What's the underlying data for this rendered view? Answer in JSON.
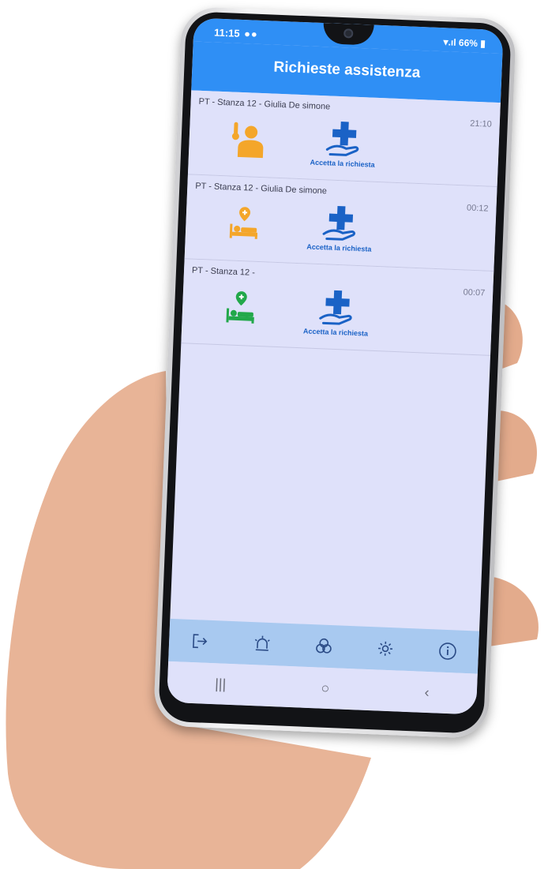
{
  "status_bar": {
    "time": "11:15",
    "battery": "66%"
  },
  "header": {
    "title": "Richieste assistenza"
  },
  "requests": [
    {
      "title": "PT - Stanza 12 - Giulia De simone",
      "time": "21:10",
      "icon": "fever-person-icon",
      "icon_color": "#f4a62a",
      "accept_label": "Accetta la richiesta"
    },
    {
      "title": "PT - Stanza 12 - Giulia De simone",
      "time": "00:12",
      "icon": "bed-alert-icon",
      "icon_color": "#f4a62a",
      "accept_label": "Accetta la richiesta"
    },
    {
      "title": "PT - Stanza 12 -",
      "time": "00:07",
      "icon": "bed-alert-icon",
      "icon_color": "#22a84a",
      "accept_label": "Accetta la richiesta"
    }
  ],
  "tabs": [
    {
      "name": "logout-icon"
    },
    {
      "name": "alarm-light-icon"
    },
    {
      "name": "pills-icon"
    },
    {
      "name": "settings-icon"
    },
    {
      "name": "info-icon"
    }
  ],
  "system_nav": {
    "recents": "|||",
    "home": "○",
    "back": "‹"
  },
  "colors": {
    "primary": "#2f8ff5",
    "accent_blue": "#1a62c6",
    "tabbar": "#a8c9f0",
    "screen_bg": "#dfe1fa"
  }
}
